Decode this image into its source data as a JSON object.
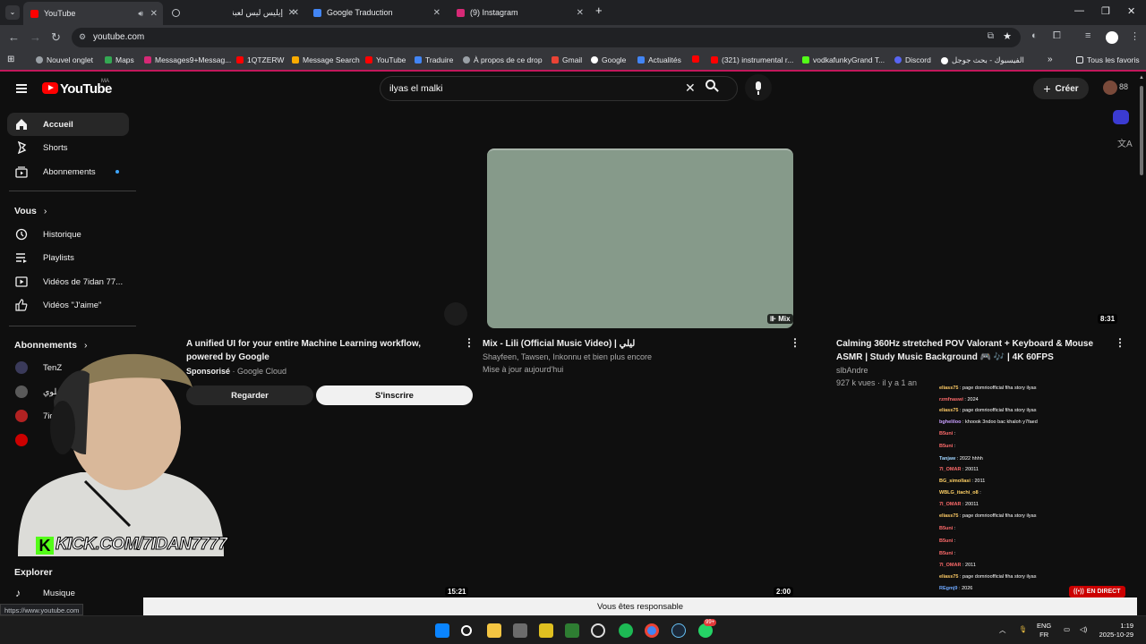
{
  "browser": {
    "tabs": [
      {
        "title": "YouTube",
        "active": true
      },
      {
        "title": "",
        "active": false
      },
      {
        "title": "إيليس ليس لعبة",
        "active": false
      },
      {
        "title": "Google Traduction",
        "active": false
      },
      {
        "title": "(9) Instagram",
        "active": false
      }
    ],
    "url": "youtube.com",
    "bookmarks": [
      "Nouvel onglet",
      "Maps",
      "Messages9+Messag...",
      "1QTZERW",
      "Message Search",
      "YouTube",
      "Traduire",
      "À propos de ce drop",
      "Gmail",
      "Google",
      "Actualités",
      "(321) instrumental r...",
      "vodkafunkyGrand T...",
      "Discord",
      "الفيسبوك - بحث جوجل"
    ],
    "all_bookmarks": "Tous les favoris",
    "status_url": "https://www.youtube.com"
  },
  "youtube": {
    "logo_text": "YouTube",
    "country_code": "MA",
    "search_value": "ilyas el malki",
    "create_label": "Créer",
    "sidebar": {
      "main": [
        "Accueil",
        "Shorts",
        "Abonnements"
      ],
      "you_header": "Vous",
      "you_items": [
        "Historique",
        "Playlists",
        "Vidéos de 7idan 77...",
        "Vidéos \"J'aime\""
      ],
      "subs_header": "Abonnements",
      "subs": [
        "TenZ",
        "العلوي",
        "7id"
      ],
      "explore_header": "Explorer",
      "explore_items": [
        "Musique"
      ]
    },
    "videos": [
      {
        "title": "A unified UI for your entire Machine Learning workflow, powered by Google",
        "channel_prefix": "Sponsorisé",
        "channel": "Google Cloud",
        "btn_watch": "Regarder",
        "btn_subscribe": "S'inscrire"
      },
      {
        "title": "Mix - Lili (Official Music Video) | ليلي",
        "channel": "Shayfeen, Tawsen, Inkonnu et bien plus encore",
        "meta": "Mise à jour aujourd'hui",
        "badge": "Mix"
      },
      {
        "title": "Calming 360Hz stretched POV Valorant + Keyboard & Mouse ASMR | Study Music Background 🎮 🎶 | 4K 60FPS",
        "channel": "slbAndre",
        "meta": "927 k vues · il y a 1 an",
        "badge": "8:31"
      }
    ],
    "bottom_durations": [
      "15:21",
      "2:00"
    ],
    "live_label": "EN DIRECT",
    "responsible_banner": "Vous êtes responsable"
  },
  "overlay": {
    "kick_text": "KICK.COM/7IDAN7777",
    "chat": [
      {
        "user": "eliass75",
        "msg": "page domrioofficial fiha story ilyas"
      },
      {
        "user": "rzmfnaswi",
        "msg": "2024"
      },
      {
        "user": "eliass75",
        "msg": "page domrioofficial fiha story ilyas"
      },
      {
        "user": "bgheliloo",
        "msg": "khoook 3ndoo bac khaloh y7faed"
      },
      {
        "user": "B5uni",
        "msg": ""
      },
      {
        "user": "B5uni",
        "msg": ""
      },
      {
        "user": "Tanjaw",
        "msg": "2022 hhhh"
      },
      {
        "user": "7I_OMAR",
        "msg": "20011"
      },
      {
        "user": "BG_simollasi",
        "msg": "2011"
      },
      {
        "user": "WBLG_itachi_o8",
        "msg": ""
      },
      {
        "user": "7I_OMAR",
        "msg": "20011"
      },
      {
        "user": "eliass75",
        "msg": "page domrioofficial fiha story ilyas"
      },
      {
        "user": "B5uni",
        "msg": ""
      },
      {
        "user": "B5uni",
        "msg": ""
      },
      {
        "user": "B5uni",
        "msg": ""
      },
      {
        "user": "7I_OMAR",
        "msg": "2011"
      },
      {
        "user": "eliass75",
        "msg": "page domrioofficial fiha story ilyas"
      },
      {
        "user": "REgmj9",
        "msg": "2026"
      }
    ]
  },
  "taskbar": {
    "lang": "ENG",
    "region": "FR",
    "time": "1:19",
    "date": "2025-10-29",
    "whatsapp_badge": "99+"
  },
  "colors": {
    "yt_red": "#ff0000",
    "bookmark_accent": "#c2185b",
    "kick_green": "#53fc18",
    "thumb_mix": "#869a8a"
  }
}
